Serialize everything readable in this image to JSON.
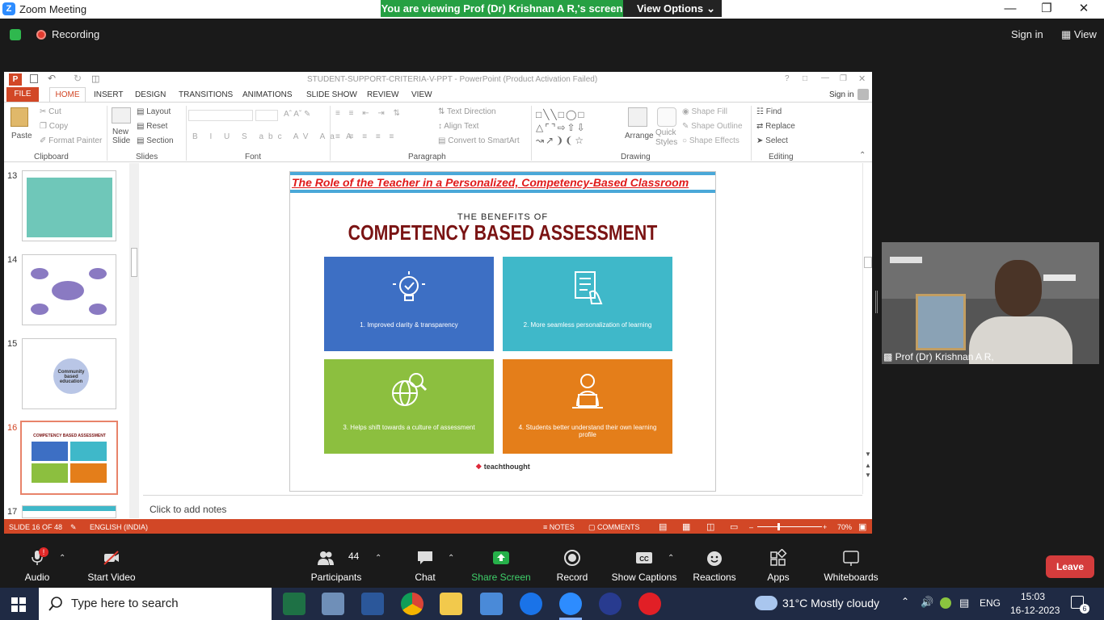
{
  "zoom": {
    "title": "Zoom Meeting",
    "share_banner": "You are viewing Prof (Dr) Krishnan A R,'s screen",
    "view_options": "View Options",
    "recording": "Recording",
    "sign_in": "Sign in",
    "view": "View",
    "speaker_name": "Prof (Dr) Krishnan A R,"
  },
  "ppt": {
    "title": "STUDENT-SUPPORT-CRITERIA-V-PPT - PowerPoint (Product Activation Failed)",
    "sign_in": "Sign in",
    "tabs": [
      "FILE",
      "HOME",
      "INSERT",
      "DESIGN",
      "TRANSITIONS",
      "ANIMATIONS",
      "SLIDE SHOW",
      "REVIEW",
      "VIEW"
    ],
    "ribbon": {
      "paste": "Paste",
      "cut": "Cut",
      "copy": "Copy",
      "format_painter": "Format Painter",
      "clipboard": "Clipboard",
      "new_slide": "New Slide",
      "layout": "Layout",
      "reset": "Reset",
      "section": "Section",
      "slides": "Slides",
      "font": "Font",
      "text_direction": "Text Direction",
      "align_text": "Align Text",
      "convert_smartart": "Convert to SmartArt",
      "paragraph": "Paragraph",
      "arrange": "Arrange",
      "quick_styles": "Quick Styles",
      "shape_fill": "Shape Fill",
      "shape_outline": "Shape Outline",
      "shape_effects": "Shape Effects",
      "drawing": "Drawing",
      "find": "Find",
      "replace": "Replace",
      "select": "Select",
      "editing": "Editing"
    },
    "thumbnails": [
      "13",
      "14",
      "15",
      "16",
      "17"
    ],
    "thumb15_text": "Community based education",
    "thumb16_title": "COMPETENCY BASED ASSESSMENT",
    "slide": {
      "header": "The Role of the Teacher in a Personalized, Competency-Based Classroom",
      "benefits": "THE BENEFITS OF",
      "title": "COMPETENCY BASED ASSESSMENT",
      "tiles": [
        {
          "text": "1. Improved clarity & transparency",
          "color": "#3d6fc4"
        },
        {
          "text": "2. More seamless personalization of learning",
          "color": "#3fb8c9"
        },
        {
          "text": "3. Helps shift towards a culture of assessment",
          "color": "#8cbf3f"
        },
        {
          "text": "4. Students better understand their own learning profile",
          "color": "#e47e1a"
        }
      ],
      "brand": "teachthought"
    },
    "notes": "Click to add notes",
    "status": {
      "slide": "SLIDE 16 OF 48",
      "language": "ENGLISH (INDIA)",
      "notes": "NOTES",
      "comments": "COMMENTS",
      "zoom": "70%"
    }
  },
  "toolbar": {
    "audio": "Audio",
    "start_video": "Start Video",
    "participants": "Participants",
    "participants_count": "44",
    "chat": "Chat",
    "share_screen": "Share Screen",
    "record": "Record",
    "show_captions": "Show Captions",
    "reactions": "Reactions",
    "apps": "Apps",
    "whiteboards": "Whiteboards",
    "leave": "Leave"
  },
  "taskbar": {
    "search": "Type here to search",
    "weather": "31°C  Mostly cloudy",
    "lang": "ENG",
    "time": "15:03",
    "date": "16-12-2023",
    "notifications": "6"
  }
}
